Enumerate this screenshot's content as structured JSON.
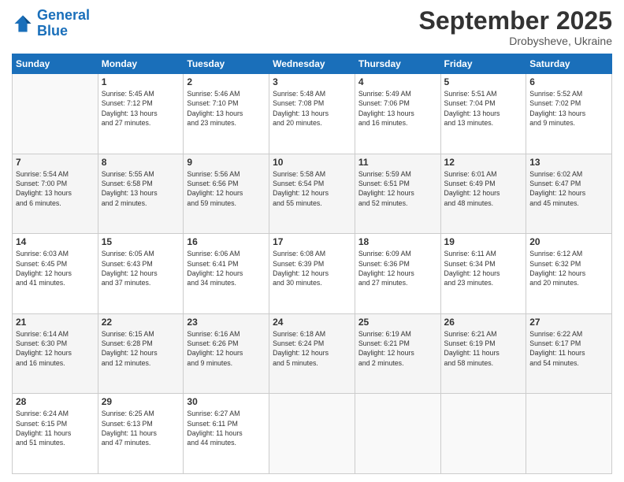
{
  "logo": {
    "line1": "General",
    "line2": "Blue"
  },
  "title": "September 2025",
  "location": "Drobysheve, Ukraine",
  "weekdays": [
    "Sunday",
    "Monday",
    "Tuesday",
    "Wednesday",
    "Thursday",
    "Friday",
    "Saturday"
  ],
  "days": [
    {
      "day": "",
      "info": ""
    },
    {
      "day": "1",
      "info": "Sunrise: 5:45 AM\nSunset: 7:12 PM\nDaylight: 13 hours\nand 27 minutes."
    },
    {
      "day": "2",
      "info": "Sunrise: 5:46 AM\nSunset: 7:10 PM\nDaylight: 13 hours\nand 23 minutes."
    },
    {
      "day": "3",
      "info": "Sunrise: 5:48 AM\nSunset: 7:08 PM\nDaylight: 13 hours\nand 20 minutes."
    },
    {
      "day": "4",
      "info": "Sunrise: 5:49 AM\nSunset: 7:06 PM\nDaylight: 13 hours\nand 16 minutes."
    },
    {
      "day": "5",
      "info": "Sunrise: 5:51 AM\nSunset: 7:04 PM\nDaylight: 13 hours\nand 13 minutes."
    },
    {
      "day": "6",
      "info": "Sunrise: 5:52 AM\nSunset: 7:02 PM\nDaylight: 13 hours\nand 9 minutes."
    },
    {
      "day": "7",
      "info": "Sunrise: 5:54 AM\nSunset: 7:00 PM\nDaylight: 13 hours\nand 6 minutes."
    },
    {
      "day": "8",
      "info": "Sunrise: 5:55 AM\nSunset: 6:58 PM\nDaylight: 13 hours\nand 2 minutes."
    },
    {
      "day": "9",
      "info": "Sunrise: 5:56 AM\nSunset: 6:56 PM\nDaylight: 12 hours\nand 59 minutes."
    },
    {
      "day": "10",
      "info": "Sunrise: 5:58 AM\nSunset: 6:54 PM\nDaylight: 12 hours\nand 55 minutes."
    },
    {
      "day": "11",
      "info": "Sunrise: 5:59 AM\nSunset: 6:51 PM\nDaylight: 12 hours\nand 52 minutes."
    },
    {
      "day": "12",
      "info": "Sunrise: 6:01 AM\nSunset: 6:49 PM\nDaylight: 12 hours\nand 48 minutes."
    },
    {
      "day": "13",
      "info": "Sunrise: 6:02 AM\nSunset: 6:47 PM\nDaylight: 12 hours\nand 45 minutes."
    },
    {
      "day": "14",
      "info": "Sunrise: 6:03 AM\nSunset: 6:45 PM\nDaylight: 12 hours\nand 41 minutes."
    },
    {
      "day": "15",
      "info": "Sunrise: 6:05 AM\nSunset: 6:43 PM\nDaylight: 12 hours\nand 37 minutes."
    },
    {
      "day": "16",
      "info": "Sunrise: 6:06 AM\nSunset: 6:41 PM\nDaylight: 12 hours\nand 34 minutes."
    },
    {
      "day": "17",
      "info": "Sunrise: 6:08 AM\nSunset: 6:39 PM\nDaylight: 12 hours\nand 30 minutes."
    },
    {
      "day": "18",
      "info": "Sunrise: 6:09 AM\nSunset: 6:36 PM\nDaylight: 12 hours\nand 27 minutes."
    },
    {
      "day": "19",
      "info": "Sunrise: 6:11 AM\nSunset: 6:34 PM\nDaylight: 12 hours\nand 23 minutes."
    },
    {
      "day": "20",
      "info": "Sunrise: 6:12 AM\nSunset: 6:32 PM\nDaylight: 12 hours\nand 20 minutes."
    },
    {
      "day": "21",
      "info": "Sunrise: 6:14 AM\nSunset: 6:30 PM\nDaylight: 12 hours\nand 16 minutes."
    },
    {
      "day": "22",
      "info": "Sunrise: 6:15 AM\nSunset: 6:28 PM\nDaylight: 12 hours\nand 12 minutes."
    },
    {
      "day": "23",
      "info": "Sunrise: 6:16 AM\nSunset: 6:26 PM\nDaylight: 12 hours\nand 9 minutes."
    },
    {
      "day": "24",
      "info": "Sunrise: 6:18 AM\nSunset: 6:24 PM\nDaylight: 12 hours\nand 5 minutes."
    },
    {
      "day": "25",
      "info": "Sunrise: 6:19 AM\nSunset: 6:21 PM\nDaylight: 12 hours\nand 2 minutes."
    },
    {
      "day": "26",
      "info": "Sunrise: 6:21 AM\nSunset: 6:19 PM\nDaylight: 11 hours\nand 58 minutes."
    },
    {
      "day": "27",
      "info": "Sunrise: 6:22 AM\nSunset: 6:17 PM\nDaylight: 11 hours\nand 54 minutes."
    },
    {
      "day": "28",
      "info": "Sunrise: 6:24 AM\nSunset: 6:15 PM\nDaylight: 11 hours\nand 51 minutes."
    },
    {
      "day": "29",
      "info": "Sunrise: 6:25 AM\nSunset: 6:13 PM\nDaylight: 11 hours\nand 47 minutes."
    },
    {
      "day": "30",
      "info": "Sunrise: 6:27 AM\nSunset: 6:11 PM\nDaylight: 11 hours\nand 44 minutes."
    },
    {
      "day": "",
      "info": ""
    },
    {
      "day": "",
      "info": ""
    },
    {
      "day": "",
      "info": ""
    },
    {
      "day": "",
      "info": ""
    }
  ]
}
